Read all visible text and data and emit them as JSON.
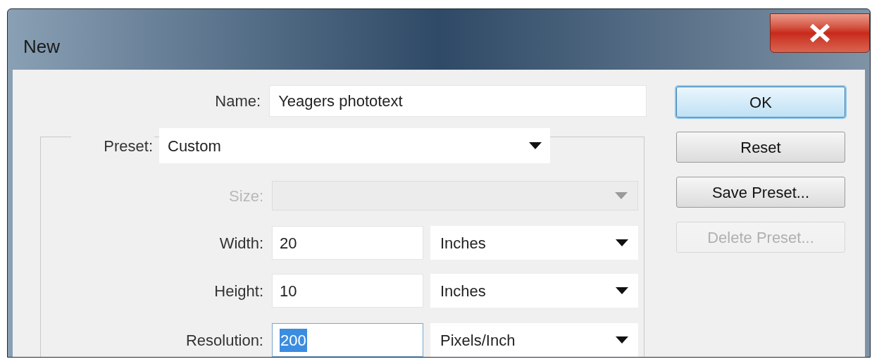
{
  "window": {
    "title": "New"
  },
  "name_field": {
    "label": "Name:",
    "value": "Yeagers phototext"
  },
  "preset": {
    "label": "Preset:",
    "value": "Custom"
  },
  "fields": [
    {
      "kind": "select",
      "label": "Size:",
      "disabled": true
    },
    {
      "kind": "value_unit",
      "label": "Width:",
      "value": "20",
      "unit": "Inches",
      "disabled": false,
      "text_selected": false
    },
    {
      "kind": "value_unit",
      "label": "Height:",
      "value": "10",
      "unit": "Inches",
      "disabled": false,
      "text_selected": false
    },
    {
      "kind": "value_unit",
      "label": "Resolution:",
      "value": "200",
      "unit": "Pixels/Inch",
      "disabled": false,
      "text_selected": true
    }
  ],
  "buttons": [
    {
      "label": "OK",
      "default": true,
      "disabled": false
    },
    {
      "label": "Reset",
      "default": false,
      "disabled": false
    },
    {
      "label": "Save Preset...",
      "default": false,
      "disabled": false
    },
    {
      "label": "Delete Preset...",
      "default": false,
      "disabled": true
    }
  ]
}
